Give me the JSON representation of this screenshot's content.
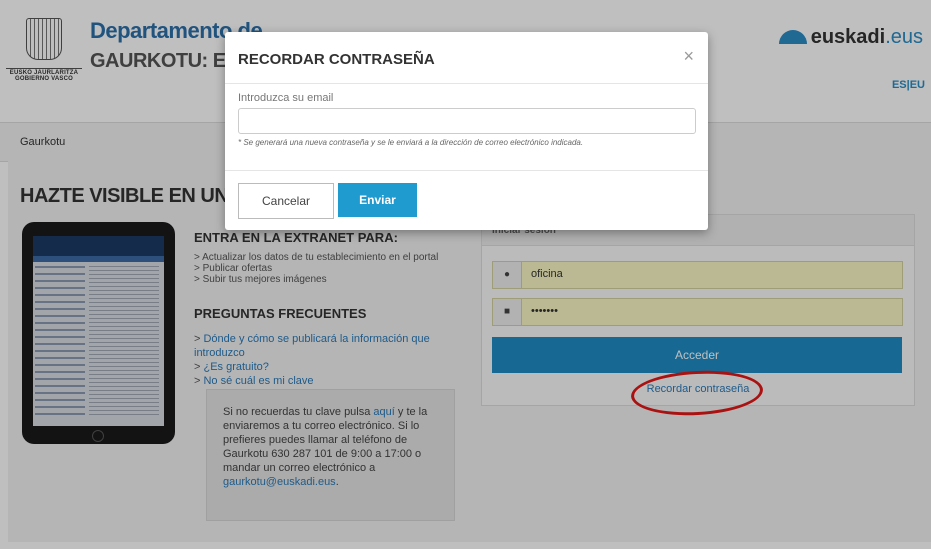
{
  "header": {
    "logo_line1": "EUSKO JAURLARITZA",
    "logo_line2": "GOBIERNO VASCO",
    "department": "Departamento de",
    "subtitle": "GAURKOTU: Extr",
    "brand": "euskadi",
    "brand_suffix": ".eus",
    "lang_es": "ES",
    "lang_sep": "|",
    "lang_eu": "EU"
  },
  "breadcrumb": {
    "item": "Gaurkotu"
  },
  "hero": {
    "title": "HAZTE VISIBLE EN UN PORTAL T"
  },
  "extranet": {
    "heading": "ENTRA EN LA EXTRANET PARA:",
    "items": [
      "> Actualizar los datos de tu establecimiento en el portal",
      "> Publicar ofertas",
      "> Subir tus mejores imágenes"
    ]
  },
  "faq": {
    "heading": "PREGUNTAS FRECUENTES",
    "items": [
      "Dónde y cómo se publicará la información que introduzco",
      "¿Es gratuito?",
      "No sé cuál es mi clave"
    ]
  },
  "note": {
    "part1": "Si no recuerdas tu clave pulsa ",
    "link": "aquí",
    "part2": " y te la enviaremos a tu correo electrónico. Si lo prefieres puedes llamar al teléfono de Gaurkotu 630 287 101 de 9:00 a 17:00 o mandar un correo electrónico a ",
    "email": "gaurkotu@euskadi.eus",
    "end": "."
  },
  "login": {
    "heading": "Iniciar sesión",
    "username": "oficina",
    "password": "•••••••",
    "submit": "Acceder",
    "forgot": "Recordar contraseña"
  },
  "modal": {
    "title": "RECORDAR CONTRASEÑA",
    "close": "×",
    "email_label": "Introduzca su email",
    "email_value": "",
    "hint": "* Se generará una nueva contraseña y se le enviará a la dirección de correo electrónico indicada.",
    "cancel": "Cancelar",
    "send": "Enviar"
  },
  "colors": {
    "primary": "#1f8dc4",
    "link": "#2a7ab8",
    "annotation": "#e31919"
  }
}
